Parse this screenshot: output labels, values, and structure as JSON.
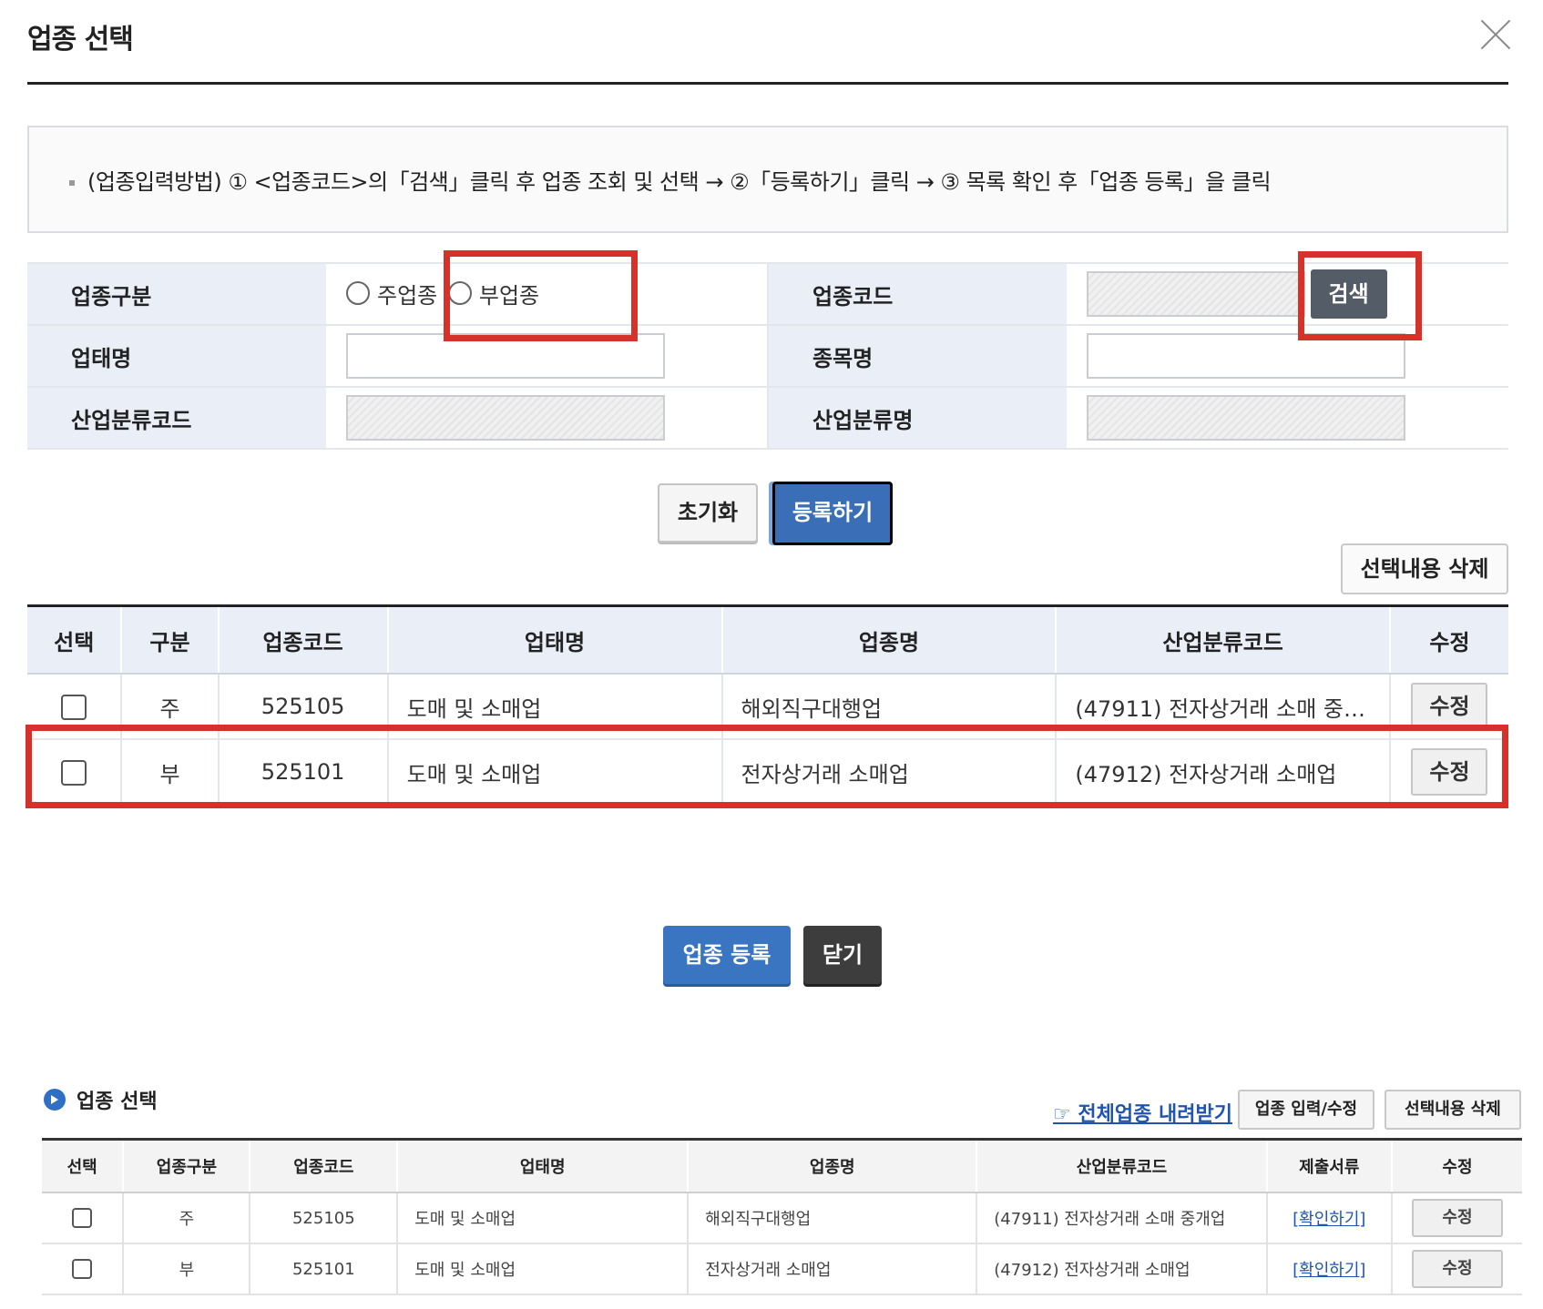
{
  "dialog": {
    "title": "업종 선택"
  },
  "guide": {
    "text": "(업종입력방법) ① <업종코드>의「검색」클릭 후 업종 조회 및 선택 → ②「등록하기」클릭 → ③ 목록 확인 후「업종 등록」을 클릭"
  },
  "form": {
    "biz_type_label": "업종구분",
    "radio_main": "주업종",
    "radio_sub": "부업종",
    "biz_code_label": "업종코드",
    "search_button": "검색",
    "biz_state_label": "업태명",
    "item_label": "종목명",
    "industry_code_label": "산업분류코드",
    "industry_name_label": "산업분류명"
  },
  "buttons": {
    "reset": "초기화",
    "register": "등록하기",
    "delete_selected": "선택내용 삭제",
    "biz_register": "업종 등록",
    "close": "닫기"
  },
  "list": {
    "headers": [
      "선택",
      "구분",
      "업종코드",
      "업태명",
      "업종명",
      "산업분류코드",
      "수정"
    ],
    "rows": [
      {
        "type": "주",
        "code": "525105",
        "state": "도매 및 소매업",
        "name": "해외직구대행업",
        "industry": "(47911) 전자상거래 소매 중…",
        "edit": "수정"
      },
      {
        "type": "부",
        "code": "525101",
        "state": "도매 및 소매업",
        "name": "전자상거래 소매업",
        "industry": "(47912) 전자상거래 소매업",
        "edit": "수정"
      }
    ]
  },
  "section2": {
    "title": "업종 선택",
    "download_link": "☞ 전체업종 내려받기",
    "input_edit_button": "업종 입력/수정",
    "delete_selected_button": "선택내용 삭제",
    "headers": [
      "선택",
      "업종구분",
      "업종코드",
      "업태명",
      "업종명",
      "산업분류코드",
      "제출서류",
      "수정"
    ],
    "rows": [
      {
        "type": "주",
        "code": "525105",
        "state": "도매 및 소매업",
        "name": "해외직구대행업",
        "industry": "(47911) 전자상거래 소매 중개업",
        "docs": "[확인하기]",
        "edit": "수정"
      },
      {
        "type": "부",
        "code": "525101",
        "state": "도매 및 소매업",
        "name": "전자상거래 소매업",
        "industry": "(47912) 전자상거래 소매업",
        "docs": "[확인하기]",
        "edit": "수정"
      }
    ]
  },
  "colors": {
    "highlight": "#d6322a",
    "primary": "#3a75c2",
    "label_bg": "#e9eef7"
  }
}
